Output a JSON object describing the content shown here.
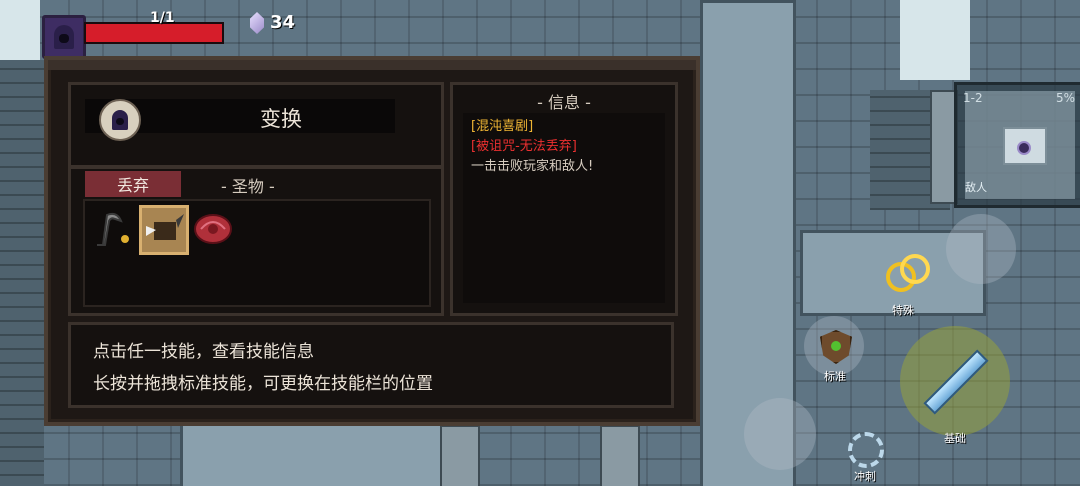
{
  "hud": {
    "hp_text": "1/1",
    "hp_fraction": 1.0,
    "gems": "34"
  },
  "panel": {
    "skill_name": "变换",
    "discard_label": "丢弃",
    "relic_title": "- 圣物 -",
    "relic_icons": [
      "scythe-icon",
      "winged-tome-icon",
      "red-shell-icon"
    ],
    "info_title": "- 信息 -",
    "info_lines": [
      "[混沌喜剧]",
      "[被诅咒-无法丢弃]",
      "一击击败玩家和敌人!"
    ],
    "tip1": "点击任一技能，查看技能信息",
    "tip2": "长按并拖拽标准技能，可更换在技能栏的位置"
  },
  "minimap": {
    "level": "1-2",
    "progress": "5%",
    "enemies_label": "敌人"
  },
  "actions": {
    "special": "特殊",
    "standard": "标准",
    "basic": "基础",
    "dash": "冲刺"
  },
  "colors": {
    "hp": "#d61d2a",
    "info_title_color": "#f0b634",
    "cursed_color": "#ec3030",
    "discard_button": "#7a2e35"
  }
}
